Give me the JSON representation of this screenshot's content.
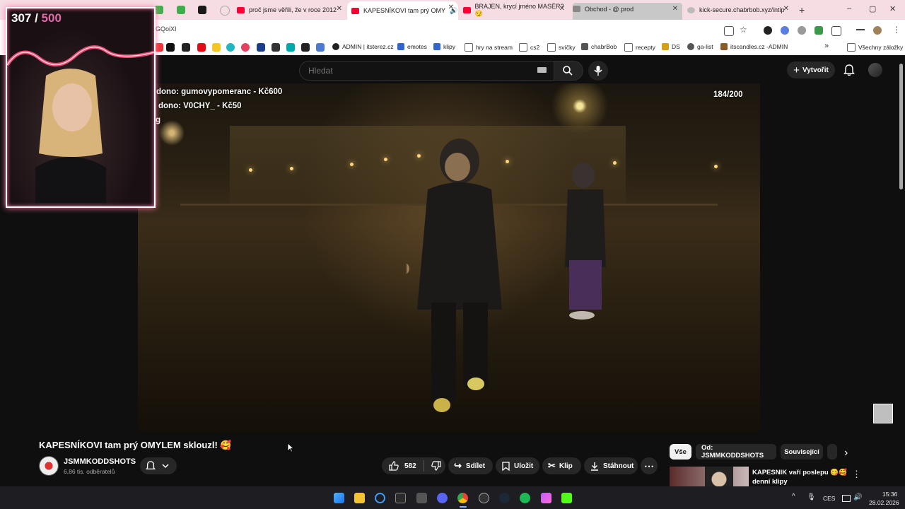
{
  "browser": {
    "tabs": [
      {
        "label": "proč jsme věřili, že v roce 2012",
        "color": "#ff0033"
      },
      {
        "label": "KAPESNÍKOVI tam prý OMY",
        "color": "#ff0033",
        "active": true
      },
      {
        "label": "BRAJEN, krycí jméno MASÉR? 😏",
        "color": "#ff0033"
      },
      {
        "label": "Obchod - @      prod",
        "color": "#888888"
      },
      {
        "label": "kick-secure.chabrbob.xyz/intip",
        "color": "#888888"
      }
    ],
    "new_tab": "+",
    "window_controls": {
      "minimize": "–",
      "maximize": "▢",
      "close": "✕"
    },
    "url": "GQoiXI",
    "bookmarks": [
      {
        "label": "ADMIN | itsterez.cz",
        "color": "#222222"
      },
      {
        "label": "emotes",
        "color": "#3366cc"
      },
      {
        "label": "klipy",
        "color": "#3366cc"
      },
      {
        "label": "hry na stream",
        "color": "#777777"
      },
      {
        "label": "cs2",
        "color": "#777777"
      },
      {
        "label": "svíčky",
        "color": "#777777"
      },
      {
        "label": "chabrBob",
        "color": "#555555"
      },
      {
        "label": "recepty",
        "color": "#777777"
      },
      {
        "label": "DS",
        "color": "#d4a017"
      },
      {
        "label": "ga-list",
        "color": "#555555"
      },
      {
        "label": "itscandles.cz -ADMIN",
        "color": "#8b5a2b"
      },
      {
        "label": "Všechny záložky",
        "color": "#777777"
      }
    ],
    "more_bookmarks": "»"
  },
  "youtube": {
    "search_placeholder": "Hledat",
    "create_label": "Vytvořit",
    "video": {
      "donation_1": "dono: gumovypomeranc - Kč600",
      "donation_2": "dono: V0CHY_ - Kč50",
      "donation_3": "g",
      "counter": "184/200"
    },
    "title": "KAPESNÍKOVI tam prý OMYLEM sklouzl! 🥰",
    "channel": {
      "name": "JSMMKODDSHOTS",
      "subscribers": "6,86 tis. odběratelů"
    },
    "actions": {
      "likes": "582",
      "share": "Sdílet",
      "save": "Uložit",
      "clip": "Klip",
      "download": "Stáhnout",
      "more": "⋯"
    },
    "chips": [
      "Vše",
      "Od: JSMMKODDSHOTS",
      "Související"
    ],
    "chip_next": "›",
    "recommendation": {
      "title": "KAPESNIK vaří poslepu 😋🥰 denní klipy",
      "menu": "⋮"
    }
  },
  "webcam": {
    "count_current": "307",
    "separator": " / ",
    "count_goal": "500"
  },
  "taskbar": {
    "tray_lang": "CES",
    "time": "15:36",
    "date": "28.02.2026",
    "tray_caret": "^"
  }
}
